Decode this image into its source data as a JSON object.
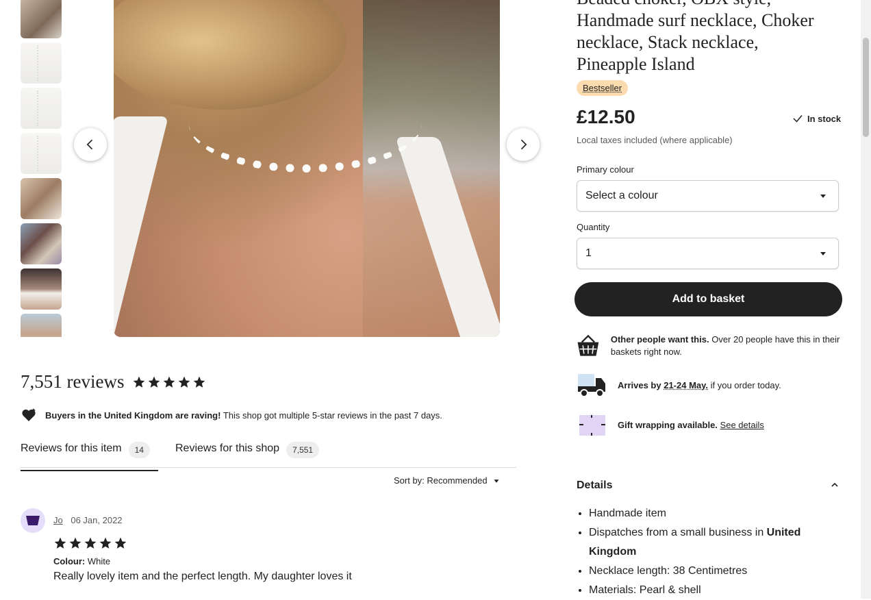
{
  "product": {
    "title_lines": [
      "Beaded choker, OBX style,",
      "Handmade surf necklace, Choker",
      "necklace, Stack necklace,",
      "Pineapple Island"
    ],
    "badge": "Bestseller",
    "price": "£12.50",
    "stock": "In stock",
    "taxes": "Local taxes included (where applicable)",
    "colour_label": "Primary colour",
    "colour_value": "Select a colour",
    "quantity_label": "Quantity",
    "quantity_value": "1",
    "add_button": "Add to basket"
  },
  "info": {
    "demand_bold": "Other people want this.",
    "demand_text": " Over 20 people have this in their baskets right now.",
    "arrives_bold": "Arrives by",
    "arrives_date": "21-24 May.",
    "arrives_text": " if you order today.",
    "gift_bold": "Gift wrapping available.",
    "gift_link": "See details"
  },
  "details": {
    "heading": "Details",
    "items": [
      "Handmade item",
      "Dispatches from a small business in ",
      "Necklace length: 38 Centimetres",
      "Materials: Pearl & shell"
    ],
    "country": "United Kingdom"
  },
  "reviews": {
    "title": "7,551 reviews",
    "raving_bold": "Buyers in the United Kingdom are raving!",
    "raving_text": "This shop got multiple 5-star reviews in the past 7 days.",
    "tabs": [
      {
        "label": "Reviews for this item",
        "count": "14"
      },
      {
        "label": "Reviews for this shop",
        "count": "7,551"
      }
    ],
    "sort": "Sort by: Recommended",
    "review": {
      "author": "Jo",
      "date": "06 Jan, 2022",
      "colour_label": "Colour:",
      "colour_value": "White",
      "text": "Really lovely item and the perfect length. My daughter loves it",
      "rating": 5
    }
  },
  "gallery": {
    "thumb_count": 8
  },
  "colors": {
    "bestseller_bg": "#fcdcae",
    "button_dark": "#222222",
    "avatar_bg": "#e5defa"
  },
  "icons": [
    "chevron-left-icon",
    "chevron-right-icon",
    "star-icon",
    "check-icon",
    "basket-icon",
    "truck-icon",
    "gift-icon",
    "heart-icon",
    "caret-down-icon",
    "chevron-up-icon"
  ]
}
